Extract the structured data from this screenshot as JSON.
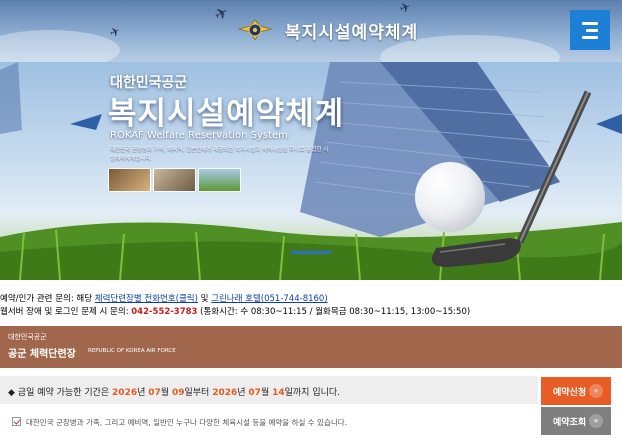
{
  "header": {
    "title": "복지시설예약체계",
    "menu_icon": "hamburger-menu-icon"
  },
  "hero": {
    "subtitle": "대한민국공군",
    "title": "복지시설예약체계",
    "english": "ROKAF Welfare Reservation System",
    "description": "대한민국 군장병과 가족, 예비역, 일반인에게 제공되는 복지시설과 체력시설을 하나로 통합한 시설예약체계입니다."
  },
  "info": {
    "line1_prefix": "예약/인가 관련 문의: 해당 ",
    "line1_link1": "체력단련장별 전화번호(클릭)",
    "line1_mid": " 및 ",
    "line1_link2": "그린나래 호텔(051-744-8160)",
    "line2_prefix": "웹서버 장애 및 로그인 문제 시 문의: ",
    "line2_phone": "042-552-3783",
    "line2_suffix": " (통화시간: 수 08:30~11:15 / 월화목금 08:30~11:15, 13:00~15:50)"
  },
  "band": {
    "subtitle": "대한민국공군",
    "title": "공군 체력단련장",
    "english": "REPUBLIC OF KOREA AIR FORCE"
  },
  "booking": {
    "prefix": "금일 예약 가능한 기간은 ",
    "start_year": "2026",
    "year_unit1": "년 ",
    "start_month": "07",
    "month_unit1": "월 ",
    "start_day": "09",
    "day_unit1": "일부터 ",
    "end_year": "2026",
    "year_unit2": "년 ",
    "end_month": "07",
    "month_unit2": "월 ",
    "end_day": "14",
    "day_unit2": "일까지",
    "suffix": " 입니다.",
    "apply_label": "예약신청",
    "check_label": "예약조회",
    "arrow": "»"
  },
  "agree": {
    "text": "대한민국 군장병과 가족, 그리고 예비역, 일반인 누구나 다양한 체육시설 등을 예약을 하실 수 있습니다."
  },
  "colors": {
    "accent_blue": "#1e7fd6",
    "band_brown": "#a0674d",
    "apply_orange": "#e85d26",
    "check_gray": "#7f7f7f",
    "highlight": "#e05c1e"
  }
}
